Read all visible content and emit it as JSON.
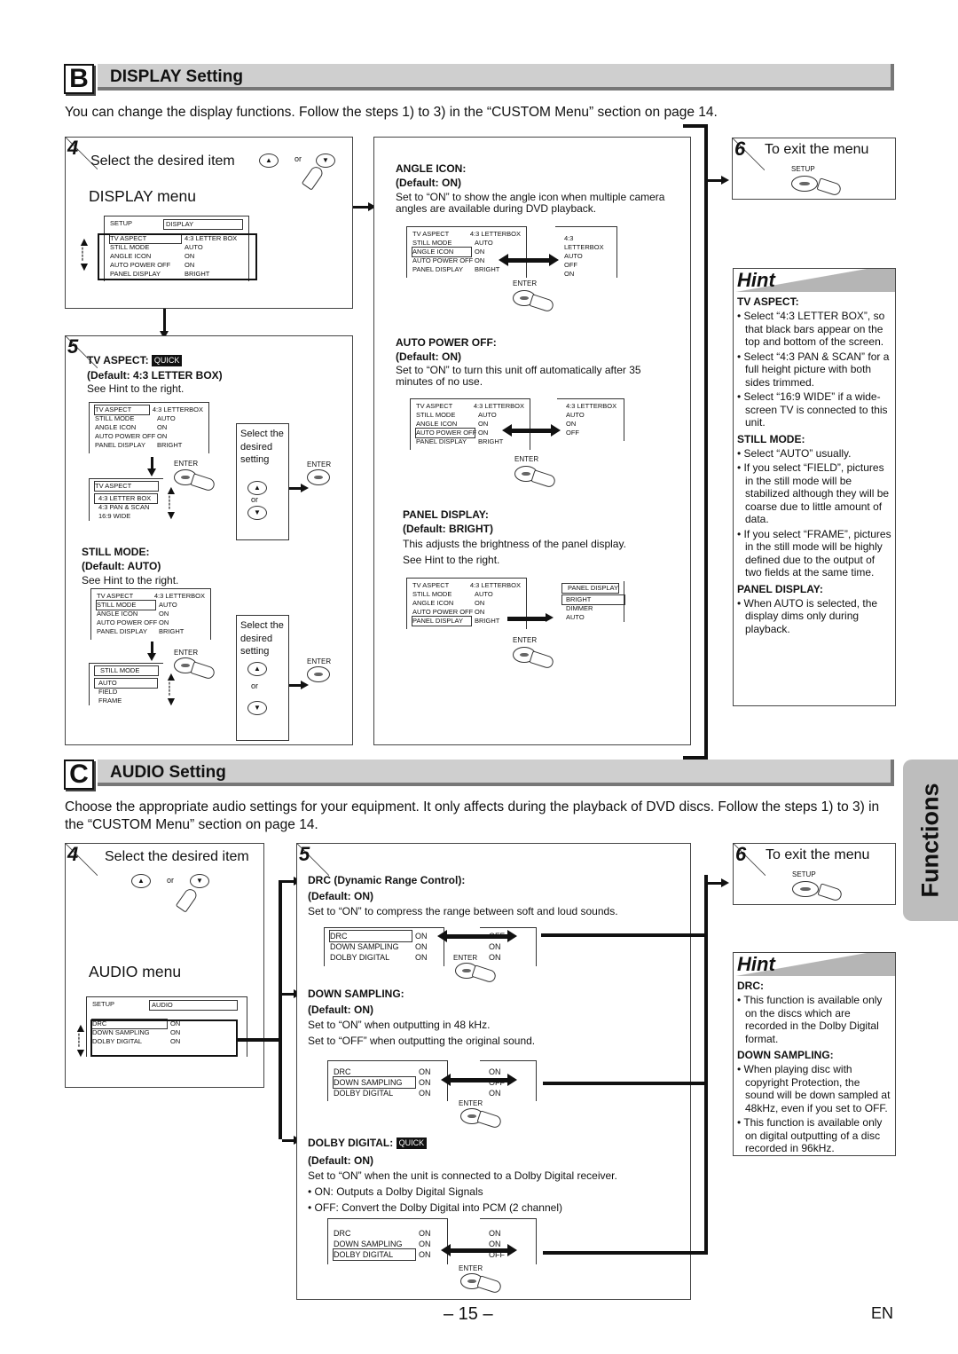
{
  "display_section": {
    "letter": "B",
    "title": "DISPLAY Setting",
    "intro": "You can change the display functions. Follow the steps 1) to 3) in the “CUSTOM Menu” section on page 14.",
    "step4": {
      "number": "4",
      "instruction": "Select the desired item",
      "or": "or",
      "menu_title": "DISPLAY menu",
      "screen": {
        "setup_label": "SETUP",
        "tab_label": "DISPLAY",
        "rows": [
          {
            "item": "TV ASPECT",
            "value": "4:3 LETTER BOX"
          },
          {
            "item": "STILL MODE",
            "value": "AUTO"
          },
          {
            "item": "ANGLE ICON",
            "value": "ON"
          },
          {
            "item": "AUTO POWER OFF",
            "value": "ON"
          },
          {
            "item": "PANEL DISPLAY",
            "value": "BRIGHT"
          }
        ]
      }
    },
    "step5": {
      "number": "5",
      "tv_aspect": {
        "heading": "TV ASPECT:",
        "badge": "QUICK",
        "default": "(Default: 4:3 LETTER BOX)",
        "note": "See Hint to the right.",
        "menu_rows": [
          {
            "item": "TV ASPECT",
            "value": "4:3 LETTERBOX"
          },
          {
            "item": "STILL MODE",
            "value": "AUTO"
          },
          {
            "item": "ANGLE ICON",
            "value": "ON"
          },
          {
            "item": "AUTO POWER OFF",
            "value": "ON"
          },
          {
            "item": "PANEL DISPLAY",
            "value": "BRIGHT"
          }
        ],
        "submenu_title": "TV ASPECT",
        "options": [
          "4:3 LETTER BOX",
          "4:3 PAN & SCAN",
          "16:9 WIDE"
        ],
        "select_text": "Select the desired setting",
        "enter": "ENTER",
        "or": "or"
      },
      "still_mode": {
        "heading": "STILL MODE:",
        "default": "(Default: AUTO)",
        "note": "See Hint to the right.",
        "menu_rows": [
          {
            "item": "TV ASPECT",
            "value": "4:3 LETTERBOX"
          },
          {
            "item": "STILL MODE",
            "value": "AUTO"
          },
          {
            "item": "ANGLE ICON",
            "value": "ON"
          },
          {
            "item": "AUTO POWER OFF",
            "value": "ON"
          },
          {
            "item": "PANEL DISPLAY",
            "value": "BRIGHT"
          }
        ],
        "submenu_title": "STILL MODE",
        "options": [
          "AUTO",
          "FIELD",
          "FRAME"
        ],
        "select_text": "Select the desired setting",
        "enter": "ENTER",
        "or": "or"
      },
      "angle_icon": {
        "heading": "ANGLE ICON:",
        "default": "(Default: ON)",
        "desc": "Set to “ON” to show the angle icon when multiple camera angles are available during DVD playback.",
        "menu_rows": [
          {
            "item": "TV ASPECT",
            "value": "4:3 LETTERBOX"
          },
          {
            "item": "STILL MODE",
            "value": "AUTO"
          },
          {
            "item": "ANGLE ICON",
            "value": "ON"
          },
          {
            "item": "AUTO POWER OFF",
            "value": "ON"
          },
          {
            "item": "PANEL DISPLAY",
            "value": "BRIGHT"
          }
        ],
        "result_values": [
          "4:3 LETTERBOX",
          "AUTO",
          "OFF",
          "ON"
        ],
        "enter": "ENTER"
      },
      "auto_power_off": {
        "heading": "AUTO POWER OFF:",
        "default": "(Default: ON)",
        "desc": "Set to “ON” to turn this unit off automatically after 35 minutes of no use.",
        "menu_rows": [
          {
            "item": "TV ASPECT",
            "value": "4:3 LETTERBOX"
          },
          {
            "item": "STILL MODE",
            "value": "AUTO"
          },
          {
            "item": "ANGLE ICON",
            "value": "ON"
          },
          {
            "item": "AUTO POWER OFF",
            "value": "ON"
          },
          {
            "item": "PANEL DISPLAY",
            "value": "BRIGHT"
          }
        ],
        "result_values": [
          "4:3 LETTERBOX",
          "AUTO",
          "ON",
          "OFF"
        ],
        "enter": "ENTER"
      },
      "panel_display": {
        "heading": "PANEL DISPLAY:",
        "default": "(Default: BRIGHT)",
        "desc": "This adjusts the brightness of the panel display.",
        "note": "See Hint to the right.",
        "menu_rows": [
          {
            "item": "TV ASPECT",
            "value": "4:3 LETTERBOX"
          },
          {
            "item": "STILL MODE",
            "value": "AUTO"
          },
          {
            "item": "ANGLE ICON",
            "value": "ON"
          },
          {
            "item": "AUTO POWER OFF",
            "value": "ON"
          },
          {
            "item": "PANEL DISPLAY",
            "value": "BRIGHT"
          }
        ],
        "submenu_title": "PANEL DISPLAY",
        "options": [
          "BRIGHT",
          "DIMMER",
          "AUTO"
        ],
        "enter": "ENTER"
      }
    },
    "step6": {
      "number": "6",
      "instruction": "To exit the menu",
      "button_label": "SETUP"
    },
    "hint": {
      "title": "Hint",
      "groups": [
        {
          "heading": "TV ASPECT:",
          "bullets": [
            "Select “4:3 LETTER BOX”, so that black bars appear on the top and bottom of the screen.",
            "Select “4:3 PAN & SCAN” for a full height picture with both sides trimmed.",
            "Select “16:9 WIDE” if a wide-screen TV is connected to this unit."
          ]
        },
        {
          "heading": "STILL MODE:",
          "bullets": [
            "Select “AUTO” usually.",
            "If you select “FIELD”, pictures in the still mode will be stabilized although they will be coarse due to little amount of data.",
            "If you select “FRAME”, pictures in the still mode will be highly defined due to the output of two fields at the same time."
          ]
        },
        {
          "heading": "PANEL DISPLAY:",
          "bullets": [
            "When AUTO is selected, the display dims only during playback."
          ]
        }
      ]
    }
  },
  "audio_section": {
    "letter": "C",
    "title": "AUDIO Setting",
    "intro": "Choose the appropriate audio settings for your equipment. It only affects during the playback of DVD discs. Follow the steps 1) to 3) in the “CUSTOM Menu” section on page 14.",
    "step4": {
      "number": "4",
      "instruction": "Select the desired item",
      "or": "or",
      "menu_title": "AUDIO menu",
      "screen": {
        "setup_label": "SETUP",
        "tab_label": "AUDIO",
        "rows": [
          {
            "item": "DRC",
            "value": "ON"
          },
          {
            "item": "DOWN SAMPLING",
            "value": "ON"
          },
          {
            "item": "DOLBY DIGITAL",
            "value": "ON"
          }
        ]
      }
    },
    "step5": {
      "number": "5",
      "drc": {
        "heading": "DRC (Dynamic Range Control):",
        "default": "(Default: ON)",
        "desc": "Set to “ON” to compress the range between soft and loud sounds.",
        "menu_rows": [
          {
            "item": "DRC",
            "value": "ON"
          },
          {
            "item": "DOWN SAMPLING",
            "value": "ON"
          },
          {
            "item": "DOLBY DIGITAL",
            "value": "ON"
          }
        ],
        "result_values": [
          "OFF",
          "ON",
          "ON"
        ],
        "enter": "ENTER"
      },
      "down_sampling": {
        "heading": "DOWN SAMPLING:",
        "default": "(Default: ON)",
        "desc1": "Set to “ON” when outputting in 48 kHz.",
        "desc2": "Set to “OFF” when outputting the original sound.",
        "menu_rows": [
          {
            "item": "DRC",
            "value": "ON"
          },
          {
            "item": "DOWN SAMPLING",
            "value": "ON"
          },
          {
            "item": "DOLBY DIGITAL",
            "value": "ON"
          }
        ],
        "result_values": [
          "ON",
          "OFF",
          "ON"
        ],
        "enter": "ENTER"
      },
      "dolby_digital": {
        "heading": "DOLBY DIGITAL:",
        "badge": "QUICK",
        "default": "(Default: ON)",
        "desc": "Set to “ON” when the unit is connected to a Dolby Digital receiver.",
        "bullet1": "• ON: Outputs a Dolby Digital Signals",
        "bullet2": "• OFF: Convert the Dolby Digital into PCM (2 channel)",
        "menu_rows": [
          {
            "item": "DRC",
            "value": "ON"
          },
          {
            "item": "DOWN SAMPLING",
            "value": "ON"
          },
          {
            "item": "DOLBY DIGITAL",
            "value": "ON"
          }
        ],
        "result_values": [
          "ON",
          "ON",
          "OFF"
        ],
        "enter": "ENTER"
      }
    },
    "step6": {
      "number": "6",
      "instruction": "To exit the menu",
      "button_label": "SETUP"
    },
    "hint": {
      "title": "Hint",
      "groups": [
        {
          "heading": "DRC:",
          "bullets": [
            "This function is available only on the discs which are recorded in the Dolby Digital format."
          ]
        },
        {
          "heading": "DOWN SAMPLING:",
          "bullets": [
            "When playing disc with copyright Protection, the sound will be down sampled at 48kHz, even if you set to OFF.",
            "This function is available only on digital outputting of a disc recorded in 96kHz."
          ]
        }
      ]
    }
  },
  "side_tab": "Functions",
  "footer": {
    "page_number": "– 15 –",
    "language": "EN"
  }
}
